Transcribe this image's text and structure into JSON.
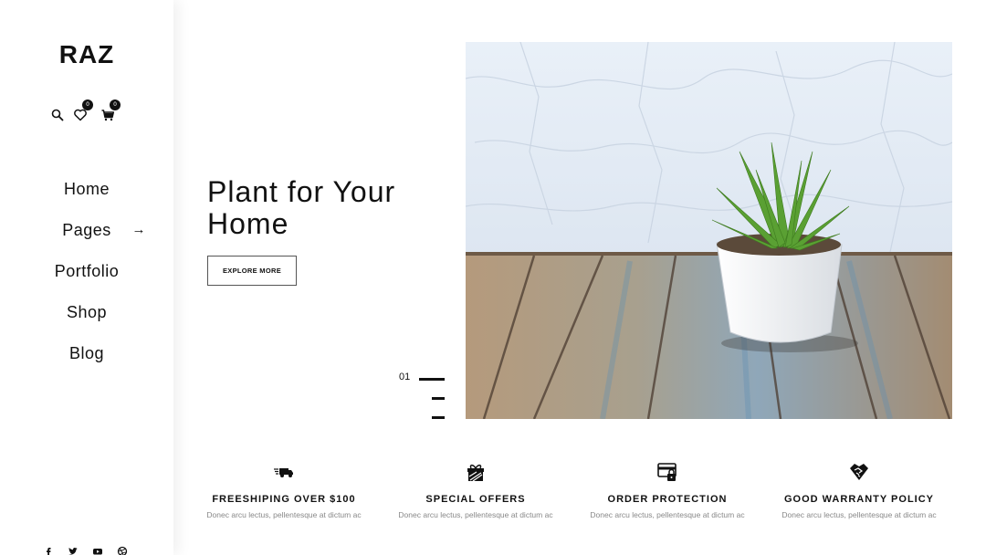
{
  "brand": {
    "logo": "RAZ"
  },
  "header_icons": {
    "wishlist_count": "0",
    "cart_count": "0"
  },
  "nav": {
    "items": [
      {
        "label": "Home"
      },
      {
        "label": "Pages",
        "has_arrow": true
      },
      {
        "label": "Portfolio"
      },
      {
        "label": "Shop"
      },
      {
        "label": "Blog"
      }
    ],
    "arrow_glyph": "→"
  },
  "social": [
    "facebook-icon",
    "twitter-icon",
    "youtube-icon",
    "dribbble-icon"
  ],
  "hero": {
    "title": "Plant for Your Home",
    "button_label": "EXPLORE MORE",
    "slide_number": "01",
    "image": "potted-succulent-on-wooden-table"
  },
  "features": [
    {
      "icon": "delivery-truck-icon",
      "title": "FREESHIPING OVER $100",
      "desc": "Donec arcu lectus, pellentesque at dictum ac"
    },
    {
      "icon": "gift-icon",
      "title": "SPECIAL OFFERS",
      "desc": "Donec arcu lectus, pellentesque at dictum ac"
    },
    {
      "icon": "secure-card-icon",
      "title": "ORDER PROTECTION",
      "desc": "Donec arcu lectus, pellentesque at dictum ac"
    },
    {
      "icon": "handshake-icon",
      "title": "GOOD WARRANTY POLICY",
      "desc": "Donec arcu lectus, pellentesque at dictum ac"
    }
  ],
  "colors": {
    "text": "#111111",
    "muted": "#888888",
    "background": "#ffffff"
  }
}
